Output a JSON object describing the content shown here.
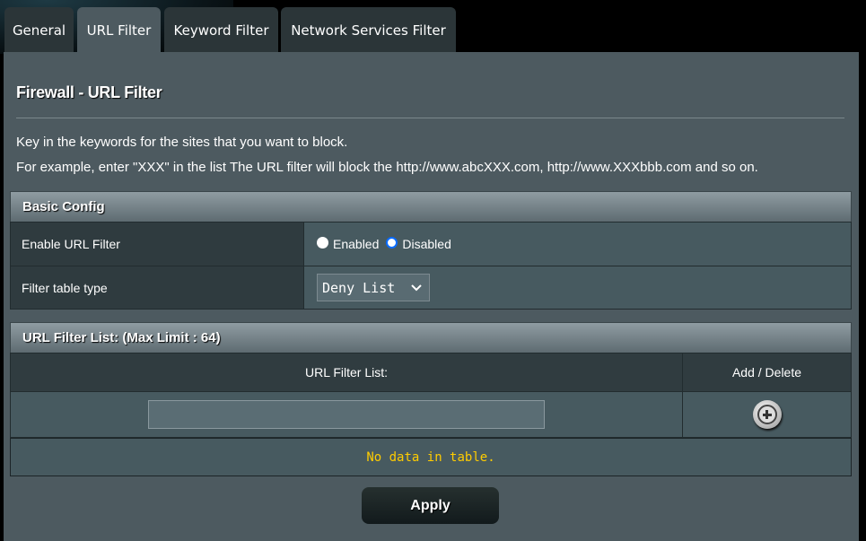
{
  "tabs": [
    {
      "label": "General",
      "active": false
    },
    {
      "label": "URL Filter",
      "active": true
    },
    {
      "label": "Keyword Filter",
      "active": false
    },
    {
      "label": "Network Services Filter",
      "active": false
    }
  ],
  "title": "Firewall - URL Filter",
  "description": [
    "Key in the keywords for the sites that you want to block.",
    "For example, enter \"XXX\" in the list The URL filter will block the http://www.abcXXX.com, http://www.XXXbbb.com and so on."
  ],
  "basic_config": {
    "header": "Basic Config",
    "enable_label": "Enable URL Filter",
    "enabled_option": "Enabled",
    "disabled_option": "Disabled",
    "selected": "Disabled",
    "filter_type_label": "Filter table type",
    "filter_type_value": "Deny List"
  },
  "url_list": {
    "header": "URL Filter List: (Max Limit : 64)",
    "col_url": "URL Filter List:",
    "col_action": "Add / Delete",
    "input_value": "",
    "empty_text": "No data in table.",
    "empty_color": "#ffcc00"
  },
  "apply_label": "Apply",
  "colors": {
    "panel": "#4d5a60",
    "tab": "#2b3538",
    "radio_accent": "#0a6cff"
  }
}
